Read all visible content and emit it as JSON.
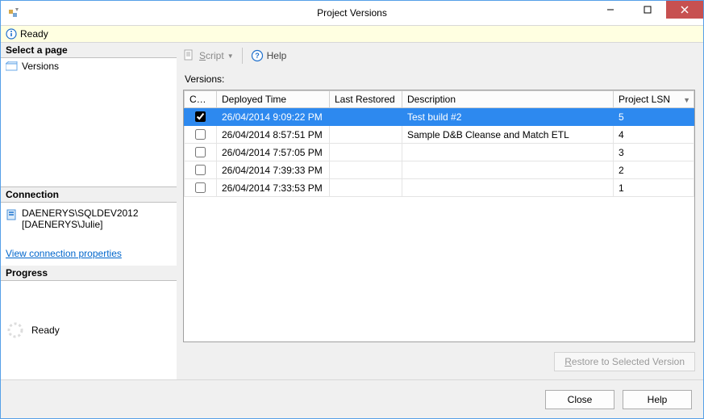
{
  "window": {
    "title": "Project Versions"
  },
  "status": {
    "text": "Ready"
  },
  "left": {
    "select_page_label": "Select a page",
    "pages": [
      {
        "label": "Versions"
      }
    ],
    "connection_label": "Connection",
    "connection_server": "DAENERYS\\SQLDEV2012",
    "connection_user": "[DAENERYS\\Julie]",
    "view_props": "View connection properties",
    "progress_label": "Progress",
    "progress_text": "Ready"
  },
  "toolbar": {
    "script_label": "Script",
    "help_label": "Help"
  },
  "versions": {
    "label": "Versions:",
    "columns": {
      "current": "Curr...",
      "deployed": "Deployed Time",
      "restored": "Last Restored",
      "description": "Description",
      "lsn": "Project LSN"
    },
    "rows": [
      {
        "current": true,
        "deployed": "26/04/2014 9:09:22 PM",
        "restored": "",
        "description": "Test build #2",
        "lsn": "5",
        "selected": true
      },
      {
        "current": false,
        "deployed": "26/04/2014 8:57:51 PM",
        "restored": "",
        "description": "Sample D&B Cleanse and Match ETL",
        "lsn": "4",
        "selected": false
      },
      {
        "current": false,
        "deployed": "26/04/2014 7:57:05 PM",
        "restored": "",
        "description": "",
        "lsn": "3",
        "selected": false
      },
      {
        "current": false,
        "deployed": "26/04/2014 7:39:33 PM",
        "restored": "",
        "description": "",
        "lsn": "2",
        "selected": false
      },
      {
        "current": false,
        "deployed": "26/04/2014 7:33:53 PM",
        "restored": "",
        "description": "",
        "lsn": "1",
        "selected": false
      }
    ],
    "restore_label": "Restore to Selected Version"
  },
  "footer": {
    "close": "Close",
    "help": "Help"
  }
}
